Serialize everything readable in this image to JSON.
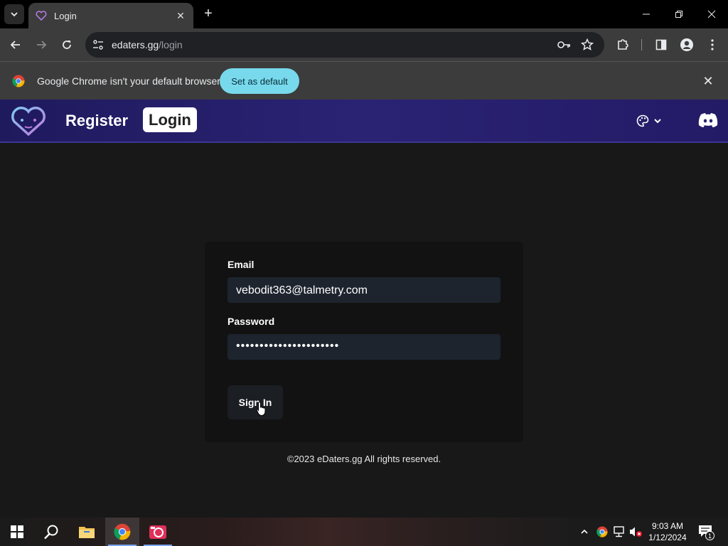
{
  "browser": {
    "tab_title": "Login",
    "url_host": "edaters.gg",
    "url_path": "/login"
  },
  "infobar": {
    "message": "Google Chrome isn't your default browser",
    "set_default_label": "Set as default"
  },
  "site": {
    "nav_register": "Register",
    "nav_login": "Login"
  },
  "form": {
    "email_label": "Email",
    "email_value": "vebodit363@talmetry.com",
    "password_label": "Password",
    "password_masked": "••••••••••••••••••••••",
    "signin_label": "Sign In"
  },
  "footer": {
    "copyright": "©2023 eDaters.gg All rights reserved."
  },
  "taskbar": {
    "time": "9:03 AM",
    "date": "1/12/2024",
    "notification_count": "1"
  },
  "colors": {
    "header_bg": "#231d6b",
    "set_default_bg": "#78d9ec",
    "field_bg": "#1e242e"
  }
}
